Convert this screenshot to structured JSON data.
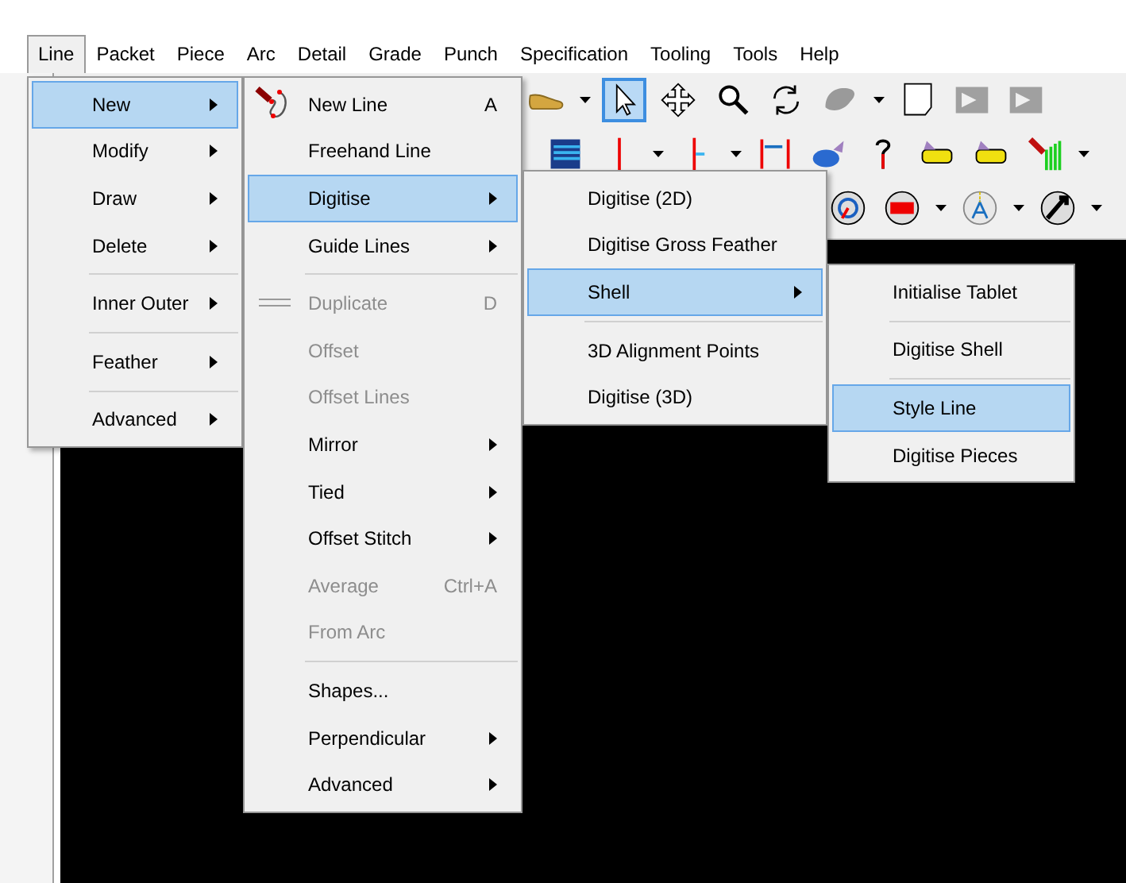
{
  "menubar": [
    {
      "label": "Line",
      "selected": true
    },
    {
      "label": "Packet",
      "selected": false
    },
    {
      "label": "Piece",
      "selected": false
    },
    {
      "label": "Arc",
      "selected": false
    },
    {
      "label": "Detail",
      "selected": false
    },
    {
      "label": "Grade",
      "selected": false
    },
    {
      "label": "Punch",
      "selected": false
    },
    {
      "label": "Specification",
      "selected": false
    },
    {
      "label": "Tooling",
      "selected": false
    },
    {
      "label": "Tools",
      "selected": false
    },
    {
      "label": "Help",
      "selected": false
    }
  ],
  "toolbars": [
    {
      "tools": [
        {
          "kind": "shoe",
          "selected": false,
          "dropdown": true
        },
        {
          "kind": "pointer",
          "selected": true,
          "dropdown": false
        },
        {
          "kind": "move",
          "selected": false,
          "dropdown": false
        },
        {
          "kind": "zoom",
          "selected": false,
          "dropdown": false
        },
        {
          "kind": "rotate",
          "selected": false,
          "dropdown": false
        },
        {
          "kind": "blob",
          "selected": false,
          "dropdown": true
        },
        {
          "kind": "page",
          "selected": false,
          "dropdown": false
        },
        {
          "kind": "grey-arrow",
          "selected": false,
          "dropdown": false
        },
        {
          "kind": "grey-arrow",
          "selected": false,
          "dropdown": false
        }
      ]
    },
    {
      "tools": [
        {
          "kind": "layers",
          "selected": false,
          "dropdown": false
        },
        {
          "kind": "red-line",
          "selected": false,
          "dropdown": true
        },
        {
          "kind": "red-tick",
          "selected": false,
          "dropdown": true
        },
        {
          "kind": "bracket",
          "selected": false,
          "dropdown": false
        },
        {
          "kind": "blue-blob",
          "selected": false,
          "dropdown": false
        },
        {
          "kind": "question",
          "selected": false,
          "dropdown": false
        },
        {
          "kind": "yellow-shoe",
          "selected": false,
          "dropdown": false
        },
        {
          "kind": "yellow-shoe",
          "selected": false,
          "dropdown": false
        },
        {
          "kind": "green-bars",
          "selected": false,
          "dropdown": true
        }
      ]
    },
    {
      "tools": [
        {
          "kind": "round-clock",
          "selected": false,
          "dropdown": false
        },
        {
          "kind": "round-red",
          "selected": false,
          "dropdown": true
        },
        {
          "kind": "round-a",
          "selected": false,
          "dropdown": true
        },
        {
          "kind": "round-all",
          "selected": false,
          "dropdown": true
        }
      ]
    }
  ],
  "menus": [
    {
      "items": [
        {
          "label": "New",
          "submenu": true,
          "selected": true,
          "disabled": false,
          "separator_before": false
        },
        {
          "label": "Modify",
          "submenu": true,
          "selected": false,
          "disabled": false,
          "separator_before": false
        },
        {
          "label": "Draw",
          "submenu": true,
          "selected": false,
          "disabled": false,
          "separator_before": false
        },
        {
          "label": "Delete",
          "submenu": true,
          "selected": false,
          "disabled": false,
          "separator_before": false
        },
        {
          "label": "Inner Outer",
          "submenu": true,
          "selected": false,
          "disabled": false,
          "separator_before": true
        },
        {
          "label": "Feather",
          "submenu": true,
          "selected": false,
          "disabled": false,
          "separator_before": true
        },
        {
          "label": "Advanced",
          "submenu": true,
          "selected": false,
          "disabled": false,
          "separator_before": true
        }
      ]
    },
    {
      "items": [
        {
          "label": "New Line",
          "shortcut": "A",
          "kind": "pen",
          "submenu": false,
          "selected": false,
          "disabled": false,
          "separator_before": false
        },
        {
          "label": "Freehand Line",
          "submenu": false,
          "selected": false,
          "disabled": false,
          "separator_before": false
        },
        {
          "label": "Digitise",
          "submenu": true,
          "selected": true,
          "disabled": false,
          "separator_before": false
        },
        {
          "label": "Guide Lines",
          "submenu": true,
          "selected": false,
          "disabled": false,
          "separator_before": false
        },
        {
          "label": "Duplicate",
          "shortcut": "D",
          "kind": "double-line",
          "submenu": false,
          "selected": false,
          "disabled": true,
          "separator_before": true
        },
        {
          "label": "Offset",
          "submenu": false,
          "selected": false,
          "disabled": true,
          "separator_before": false
        },
        {
          "label": "Offset Lines",
          "submenu": false,
          "selected": false,
          "disabled": true,
          "separator_before": false
        },
        {
          "label": "Mirror",
          "submenu": true,
          "selected": false,
          "disabled": false,
          "separator_before": false
        },
        {
          "label": "Tied",
          "submenu": true,
          "selected": false,
          "disabled": false,
          "separator_before": false
        },
        {
          "label": "Offset Stitch",
          "submenu": true,
          "selected": false,
          "disabled": false,
          "separator_before": false
        },
        {
          "label": "Average",
          "shortcut": "Ctrl+A",
          "submenu": false,
          "selected": false,
          "disabled": true,
          "separator_before": false
        },
        {
          "label": "From Arc",
          "submenu": false,
          "selected": false,
          "disabled": true,
          "separator_before": false
        },
        {
          "label": "Shapes...",
          "submenu": false,
          "selected": false,
          "disabled": false,
          "separator_before": true
        },
        {
          "label": "Perpendicular",
          "submenu": true,
          "selected": false,
          "disabled": false,
          "separator_before": false
        },
        {
          "label": "Advanced",
          "submenu": true,
          "selected": false,
          "disabled": false,
          "separator_before": false
        }
      ]
    },
    {
      "items": [
        {
          "label": "Digitise (2D)",
          "submenu": false,
          "selected": false,
          "disabled": false,
          "separator_before": false
        },
        {
          "label": "Digitise Gross Feather",
          "submenu": false,
          "selected": false,
          "disabled": false,
          "separator_before": false
        },
        {
          "label": "Shell",
          "submenu": true,
          "selected": true,
          "disabled": false,
          "separator_before": false
        },
        {
          "label": "3D Alignment Points",
          "submenu": false,
          "selected": false,
          "disabled": false,
          "separator_before": true
        },
        {
          "label": "Digitise (3D)",
          "submenu": false,
          "selected": false,
          "disabled": false,
          "separator_before": false
        }
      ]
    },
    {
      "items": [
        {
          "label": "Initialise Tablet",
          "submenu": false,
          "selected": false,
          "disabled": false,
          "separator_before": false
        },
        {
          "label": "Digitise Shell",
          "submenu": false,
          "selected": false,
          "disabled": false,
          "separator_before": true
        },
        {
          "label": "Style Line",
          "submenu": false,
          "selected": true,
          "disabled": false,
          "separator_before": true
        },
        {
          "label": "Digitise Pieces",
          "submenu": false,
          "selected": false,
          "disabled": false,
          "separator_before": false
        }
      ]
    }
  ]
}
